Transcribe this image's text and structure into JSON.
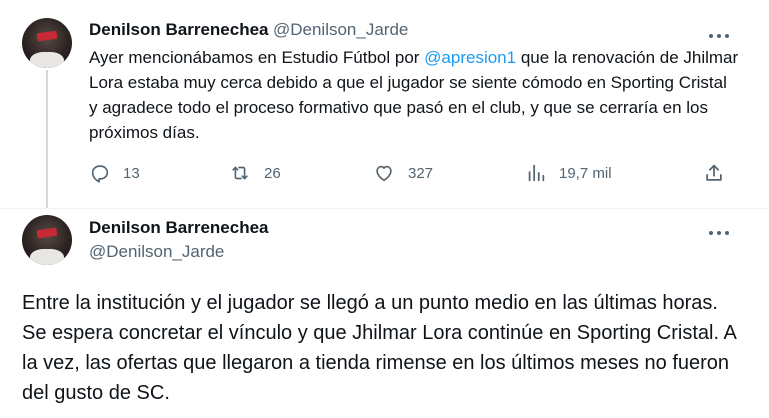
{
  "tweet1": {
    "author_name": "Denilson Barrenechea",
    "author_handle": "@Denilson_Jarde",
    "text_before": "Ayer mencionábamos en Estudio Fútbol por ",
    "mention": "@apresion1",
    "text_after": " que la renovación de Jhilmar Lora estaba muy cerca debido a que el jugador se siente cómodo en Sporting Cristal y agradece todo el proceso formativo que pasó en el club, y que se cerraría en los próximos días.",
    "replies": "13",
    "retweets": "26",
    "likes": "327",
    "views": "19,7 mil"
  },
  "tweet2": {
    "author_name": "Denilson Barrenechea",
    "author_handle": "@Denilson_Jarde",
    "text": "Entre la institución y el jugador se llegó a un punto medio en las últimas horas. Se espera concretar el vínculo y que Jhilmar Lora continúe en Sporting Cristal. A la vez, las ofertas que llegaron a tienda rimense en los últimos meses no fueron del gusto de SC."
  },
  "icons": [
    "more-icon",
    "reply-icon",
    "retweet-icon",
    "like-icon",
    "views-icon",
    "share-icon"
  ],
  "colors": {
    "text": "#0f1419",
    "secondary": "#536471",
    "link": "#1d9bf0",
    "thread_line": "#cfd9de"
  }
}
